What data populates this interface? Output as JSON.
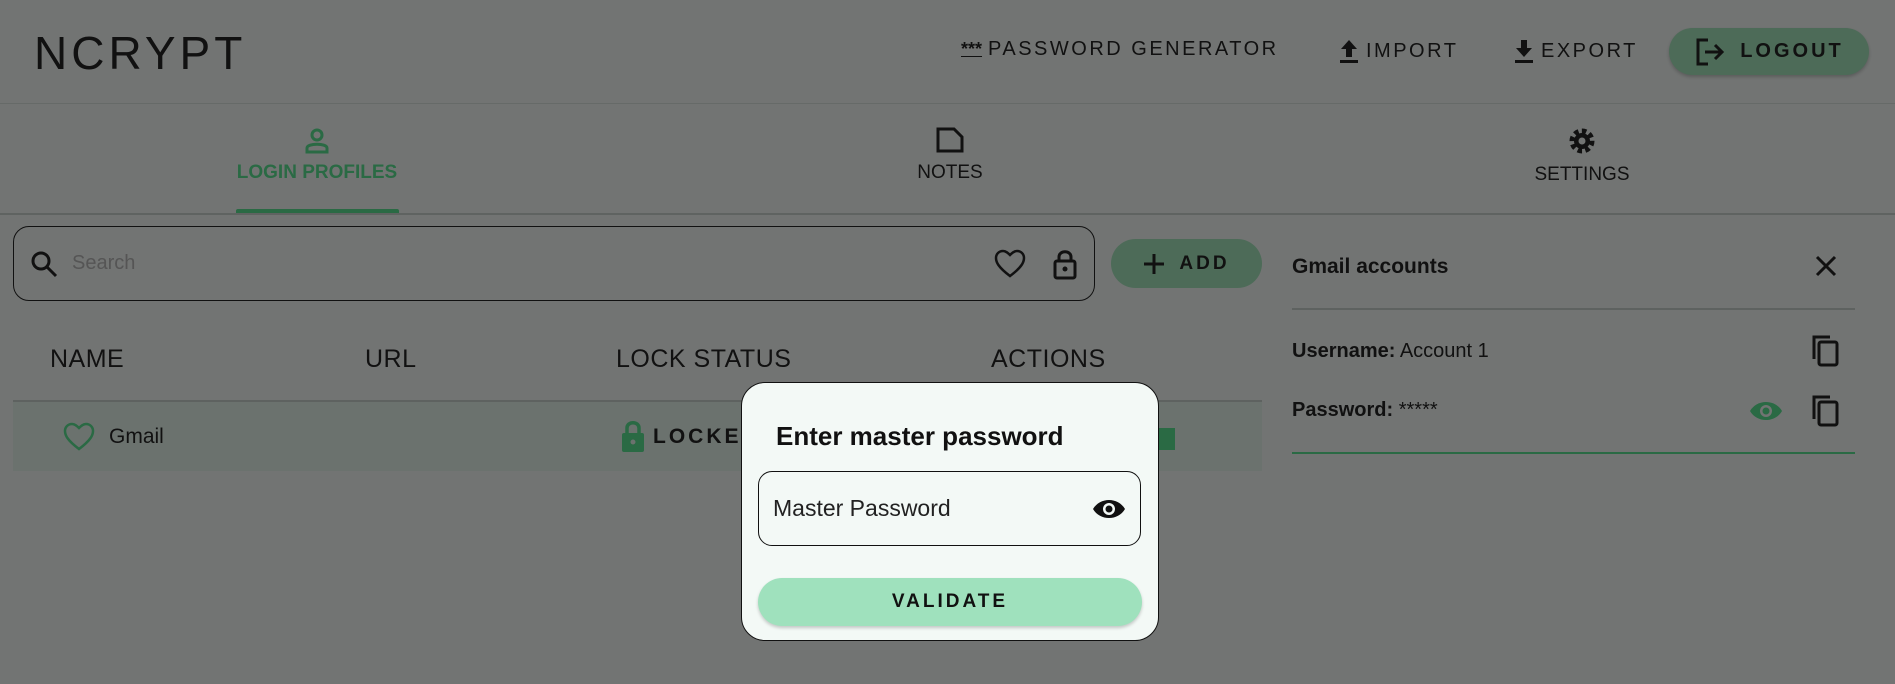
{
  "app": {
    "title": "NCRYPT"
  },
  "header": {
    "password_generator": "PASSWORD GENERATOR",
    "password_generator_icon_text": "***",
    "import": "IMPORT",
    "export": "EXPORT",
    "logout": "LOGOUT"
  },
  "tabs": [
    {
      "label": "LOGIN PROFILES",
      "active": true
    },
    {
      "label": "NOTES",
      "active": false
    },
    {
      "label": "SETTINGS",
      "active": false
    }
  ],
  "search": {
    "placeholder": "Search"
  },
  "add_button": "ADD",
  "table": {
    "headers": [
      "NAME",
      "URL",
      "LOCK STATUS",
      "ACTIONS"
    ],
    "rows": [
      {
        "name": "Gmail",
        "url": "",
        "lock_status": "LOCKED"
      }
    ]
  },
  "details": {
    "title": "Gmail accounts",
    "username_label": "Username:",
    "username_value": "Account 1",
    "password_label": "Password:",
    "password_value": "*****"
  },
  "modal": {
    "title": "Enter master password",
    "input_placeholder": "Master Password",
    "validate": "VALIDATE"
  },
  "colors": {
    "accent": "#2a6a44",
    "validate": "#9fe1bd",
    "overlay_bg": "#727473"
  }
}
